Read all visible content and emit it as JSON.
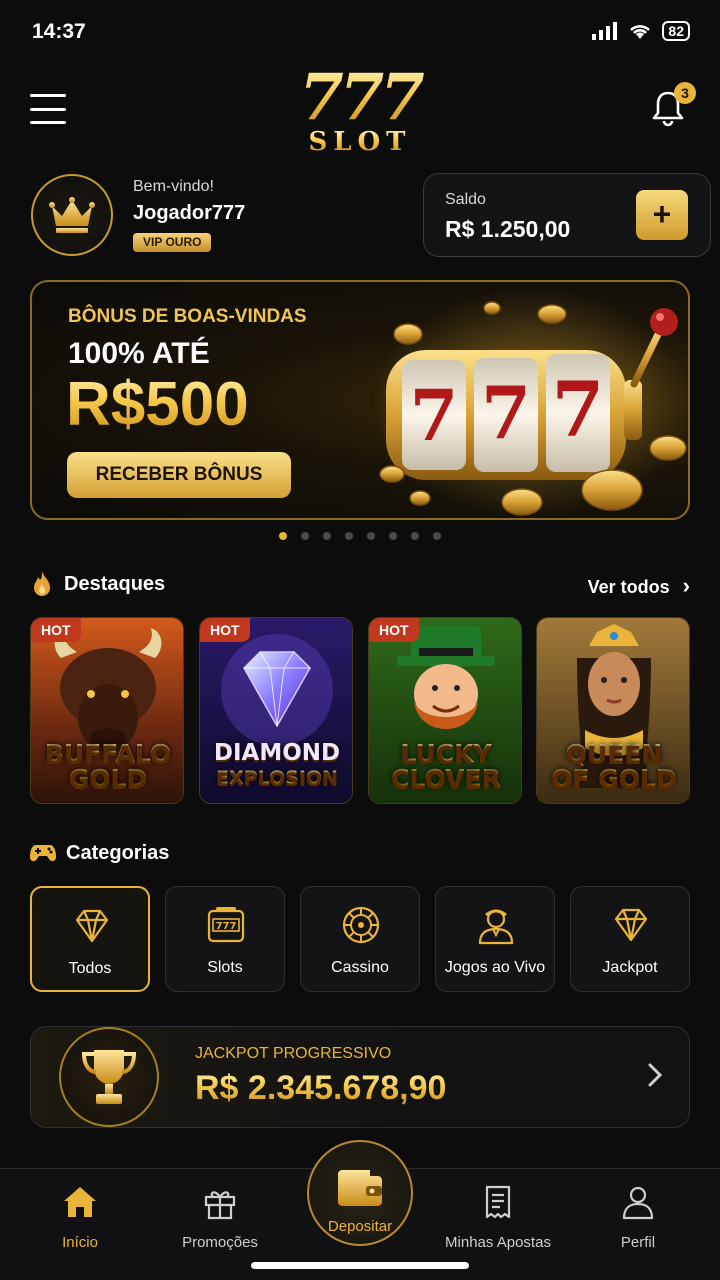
{
  "status_bar": {
    "time": "14:37",
    "battery": "82"
  },
  "header": {
    "logo_number": "777",
    "logo_word": "SLOT",
    "notification_count": "3"
  },
  "user": {
    "welcome": "Bem-vindo!",
    "name": "Jogador777",
    "vip": "VIP OURO"
  },
  "balance": {
    "label": "Saldo",
    "value": "R$ 1.250,00",
    "add_label": "+"
  },
  "banner": {
    "subtitle": "BÔNUS DE BOAS-VINDAS",
    "line1": "100% ATÉ",
    "line2": "R$500",
    "button": "RECEBER BÔNUS",
    "slot_digits": [
      "7",
      "7",
      "7"
    ],
    "carousel_pages": 8,
    "carousel_active": 0
  },
  "featured": {
    "title": "Destaques",
    "see_all": "Ver todos",
    "games": [
      {
        "badge": "HOT",
        "title_line1": "BUFFALO",
        "title_line2": "GOLD"
      },
      {
        "badge": "HOT",
        "title_line1": "DIAMOND",
        "title_line2": "EXPLOSION"
      },
      {
        "badge": "HOT",
        "title_line1": "LUCKY",
        "title_line2": "CLOVER"
      },
      {
        "badge": "",
        "title_line1": "QUEEN",
        "title_line2": "OF GOLD"
      }
    ]
  },
  "categories": {
    "title": "Categorias",
    "items": [
      {
        "label": "Todos",
        "icon": "diamond-icon",
        "active": true
      },
      {
        "label": "Slots",
        "icon": "slot-machine-icon",
        "active": false
      },
      {
        "label": "Cassino",
        "icon": "roulette-icon",
        "active": false
      },
      {
        "label": "Jogos ao Vivo",
        "icon": "live-dealer-icon",
        "active": false
      },
      {
        "label": "Jackpot",
        "icon": "diamond-icon",
        "active": false
      }
    ]
  },
  "jackpot": {
    "label": "JACKPOT PROGRESSIVO",
    "value": "R$ 2.345.678,90"
  },
  "bottom_nav": {
    "items": [
      {
        "label": "Início",
        "icon": "home-icon",
        "active": true
      },
      {
        "label": "Promoções",
        "icon": "gift-icon",
        "active": false
      },
      {
        "label": "Depositar",
        "icon": "wallet-icon",
        "active": false
      },
      {
        "label": "Minhas Apostas",
        "icon": "receipt-icon",
        "active": false
      },
      {
        "label": "Perfil",
        "icon": "user-icon",
        "active": false
      }
    ]
  },
  "colors": {
    "gold": "#e8b53a",
    "background": "#0c0c0d",
    "hot": "#c0391e"
  }
}
